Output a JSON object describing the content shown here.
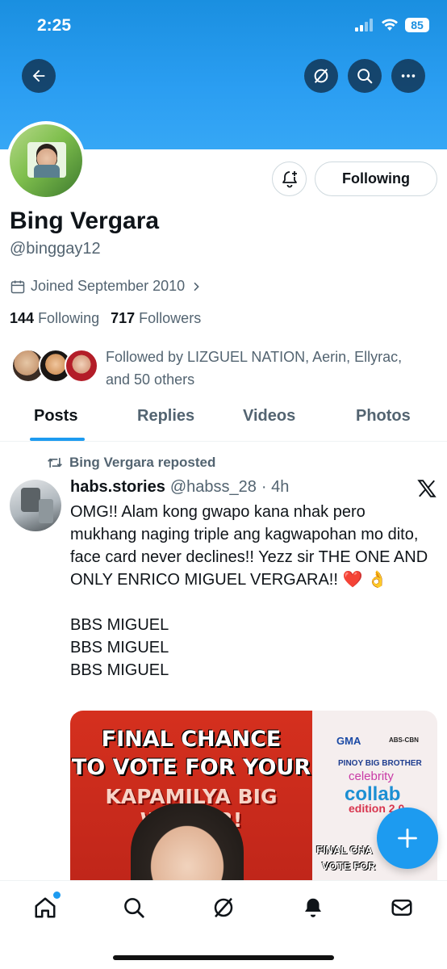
{
  "status_bar": {
    "time": "2:25",
    "battery": "85"
  },
  "header": {
    "icons": [
      "back-arrow-icon",
      "grok-icon",
      "search-icon",
      "more-icon"
    ]
  },
  "profile": {
    "display_name": "Bing Vergara",
    "handle": "@binggay12",
    "joined": "Joined September 2010",
    "following_count": "144",
    "following_label": "Following",
    "followers_count": "717",
    "followers_label": "Followers",
    "followed_by": "Followed by LIZGUEL NATION, Aerin, Ellyrac, and 50 others",
    "follow_button": "Following"
  },
  "tabs": [
    {
      "label": "Posts",
      "active": true
    },
    {
      "label": "Replies",
      "active": false
    },
    {
      "label": "Videos",
      "active": false
    },
    {
      "label": "Photos",
      "active": false
    }
  ],
  "post": {
    "repost_label": "Bing Vergara reposted",
    "author": "habs.stories",
    "handle": "@habss_28",
    "time": "· 4h",
    "text": "OMG!! Alam kong gwapo kana nhak pero mukhang naging triple ang kagwapohan mo dito, face card never declines!! Yezz sir THE ONE AND ONLY ENRICO MIGUEL VERGARA!! ❤️ 👌\n\nBBS MIGUEL\nBBS MIGUEL\nBBS MIGUEL",
    "media": {
      "line1": "FINAL CHANCE",
      "line2": "TO VOTE FOR YOUR",
      "line3": "KAPAMILYA BIG WINNER!",
      "gma": "GMA",
      "abs": "ABS-CBN",
      "pbb": "PINOY BIG BROTHER",
      "celebrity": "celebrity",
      "collab": "collab",
      "edition": "edition 2.0",
      "final": "FINAL CHA",
      "vote": "VOTE FOR"
    }
  },
  "colors": {
    "accent": "#1d9bf0",
    "banner": "#2b9ef2",
    "muted_text": "#536471"
  },
  "bottom_nav": [
    "home-icon",
    "search-icon",
    "grok-icon",
    "notifications-icon",
    "messages-icon"
  ]
}
